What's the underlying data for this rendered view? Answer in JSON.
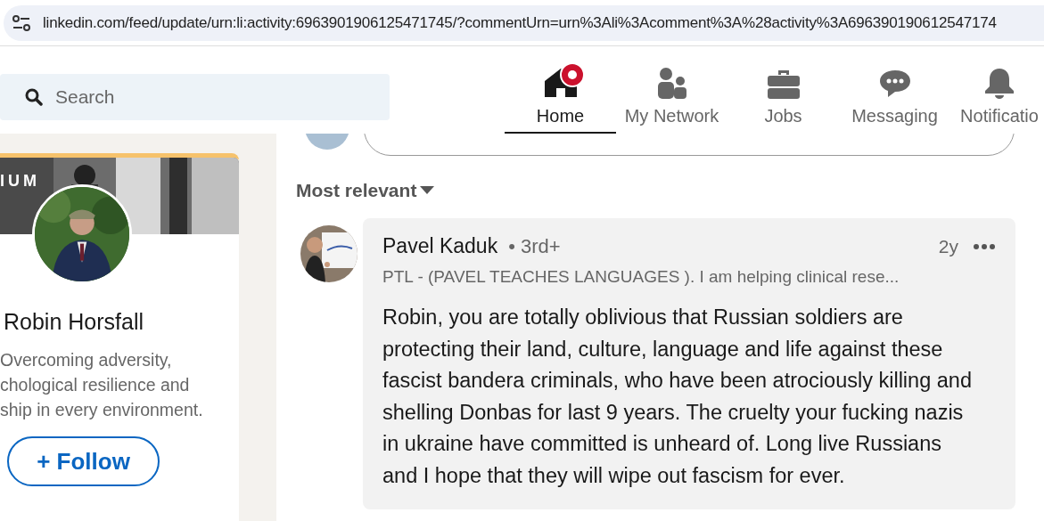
{
  "address_bar": {
    "url": "linkedin.com/feed/update/urn:li:activity:6963901906125471745/?commentUrn=urn%3Ali%3Acomment%3A%28activity%3A696390190612547174"
  },
  "search": {
    "placeholder": "Search"
  },
  "nav": [
    {
      "label": "Home",
      "kind": "home",
      "selected": true,
      "badge": true
    },
    {
      "label": "My Network",
      "kind": "network",
      "selected": false,
      "badge": false
    },
    {
      "label": "Jobs",
      "kind": "jobs",
      "selected": false,
      "badge": false
    },
    {
      "label": "Messaging",
      "kind": "messaging",
      "selected": false,
      "badge": false
    },
    {
      "label": "Notificatio",
      "kind": "notifications",
      "selected": false,
      "badge": false
    }
  ],
  "profile_card": {
    "banner_text": "IUM",
    "name": "Robin Horsfall",
    "headline": [
      "Overcoming adversity,",
      "chological resilience and",
      "ship in every environment."
    ],
    "follow_button": "+ Follow"
  },
  "sort": {
    "label": "Most relevant"
  },
  "comment": {
    "author": "Pavel Kaduk",
    "degree": "• 3rd+",
    "subtitle": "PTL - (PAVEL TEACHES LANGUAGES ). I am helping clinical rese...",
    "time": "2y",
    "text": "Robin, you are totally oblivious that Russian soldiers are protecting their land, culture, language and life against these fascist bandera criminals, who have been atrociously killing and shelling Donbas for last 9 years. The cruelty your fucking nazis in ukraine have committed is unheard of. Long live Russians and I hope that they will wipe out fascism for ever."
  }
}
